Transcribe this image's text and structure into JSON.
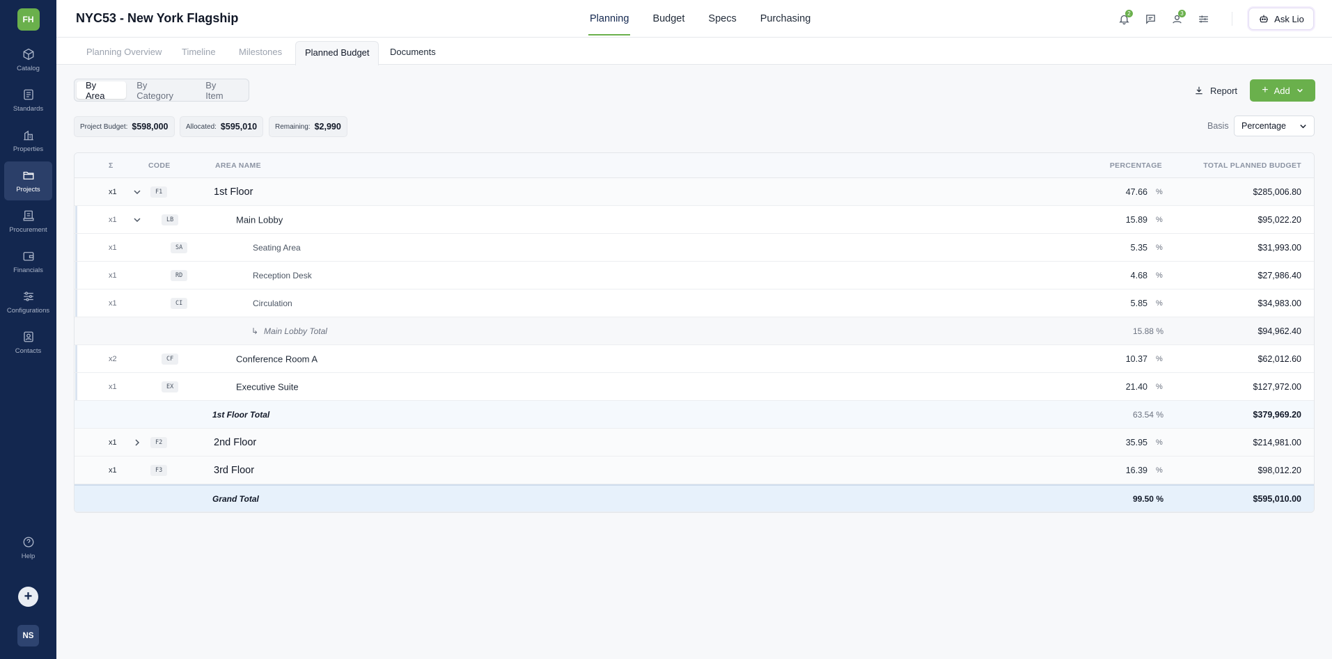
{
  "sidebar": {
    "logo": "FH",
    "items": [
      {
        "label": "Catalog",
        "icon": "cube-icon"
      },
      {
        "label": "Standards",
        "icon": "book-icon"
      },
      {
        "label": "Properties",
        "icon": "building-icon"
      },
      {
        "label": "Projects",
        "icon": "folder-icon",
        "active": true
      },
      {
        "label": "Procurement",
        "icon": "receipt-icon"
      },
      {
        "label": "Financials",
        "icon": "wallet-icon"
      },
      {
        "label": "Configurations",
        "icon": "sliders-icon"
      },
      {
        "label": "Contacts",
        "icon": "contact-card-icon"
      }
    ],
    "help_label": "Help",
    "user_initials": "NS"
  },
  "header": {
    "title": "NYC53 - New York Flagship",
    "tabs": [
      "Planning",
      "Budget",
      "Specs",
      "Purchasing"
    ],
    "active_tab": "Planning",
    "notifications_count": "2",
    "mentions_count": "3",
    "ask_label": "Ask Lio"
  },
  "subtabs": [
    "Planning Overview",
    "Timeline",
    "Milestones",
    "Planned Budget",
    "Documents"
  ],
  "toolbar": {
    "view_options": [
      "By Area",
      "By Category",
      "By Item"
    ],
    "active_view": "By Area",
    "report_label": "Report",
    "add_label": "Add",
    "stats": [
      {
        "label": "Project Budget:",
        "value": "$598,000"
      },
      {
        "label": "Allocated:",
        "value": "$595,010"
      },
      {
        "label": "Remaining:",
        "value": "$2,990"
      }
    ],
    "basis_label": "Basis",
    "basis_value": "Percentage"
  },
  "table": {
    "headers": {
      "sigma": "Σ",
      "code": "CODE",
      "name": "AREA NAME",
      "percentage": "PERCENTAGE",
      "total": "TOTAL PLANNED BUDGET"
    },
    "rows": [
      {
        "type": "floor",
        "mult": "x1",
        "code": "F1",
        "name": "1st Floor",
        "pct": "47.66",
        "unit": "%",
        "total": "$285,006.80",
        "chevron": "down"
      },
      {
        "type": "child",
        "mult": "x1",
        "code": "LB",
        "name": "Main Lobby",
        "pct": "15.89",
        "unit": "%",
        "total": "$95,022.20",
        "chevron": "down"
      },
      {
        "type": "grandchild",
        "mult": "x1",
        "code": "SA",
        "name": "Seating Area",
        "pct": "5.35",
        "unit": "%",
        "total": "$31,993.00"
      },
      {
        "type": "grandchild",
        "mult": "x1",
        "code": "RD",
        "name": "Reception Desk",
        "pct": "4.68",
        "unit": "%",
        "total": "$27,986.40"
      },
      {
        "type": "grandchild",
        "mult": "x1",
        "code": "CI",
        "name": "Circulation",
        "pct": "5.85",
        "unit": "%",
        "total": "$34,983.00"
      },
      {
        "type": "subtotal",
        "name": "Main Lobby Total",
        "pct": "15.88 %",
        "total": "$94,962.40"
      },
      {
        "type": "child",
        "mult": "x2",
        "code": "CF",
        "name": "Conference Room A",
        "pct": "10.37",
        "unit": "%",
        "total": "$62,012.60"
      },
      {
        "type": "child",
        "mult": "x1",
        "code": "EX",
        "name": "Executive Suite",
        "pct": "21.40",
        "unit": "%",
        "total": "$127,972.00"
      },
      {
        "type": "floortotal",
        "name": "1st Floor Total",
        "pct": "63.54 %",
        "total": "$379,969.20"
      },
      {
        "type": "floor",
        "mult": "x1",
        "code": "F2",
        "name": "2nd Floor",
        "pct": "35.95",
        "unit": "%",
        "total": "$214,981.00",
        "chevron": "right"
      },
      {
        "type": "floor",
        "mult": "x1",
        "code": "F3",
        "name": "3rd Floor",
        "pct": "16.39",
        "unit": "%",
        "total": "$98,012.20"
      }
    ],
    "grand_total": {
      "name": "Grand Total",
      "pct": "99.50 %",
      "total": "$595,010.00"
    }
  }
}
